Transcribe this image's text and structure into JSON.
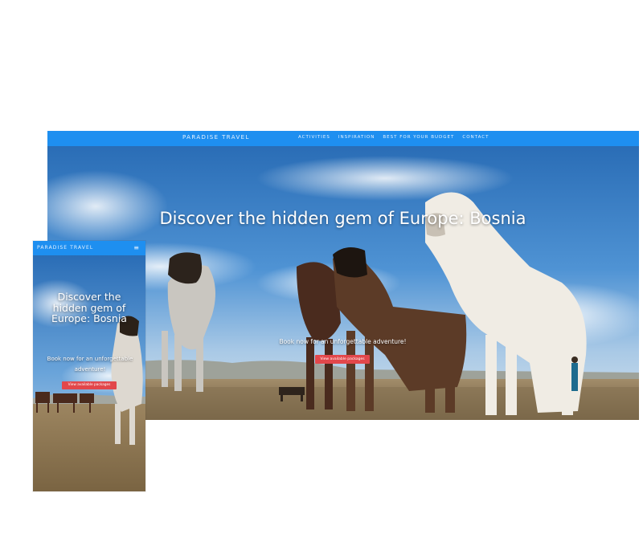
{
  "brand": "PARADISE TRAVEL",
  "nav": {
    "items": [
      {
        "label": "ACTIVITIES"
      },
      {
        "label": "INSPIRATION"
      },
      {
        "label": "BEST FOR YOUR BUDGET"
      },
      {
        "label": "CONTACT"
      }
    ],
    "menu_icon": "≡"
  },
  "hero": {
    "title": "Discover the hidden gem of Europe: Bosnia",
    "subtitle": "Book now for an unforgettable adventure!",
    "cta_label": "View available packages"
  },
  "colors": {
    "nav": "#1e8ff0",
    "cta": "#e2474b"
  },
  "icons": {
    "menu": "hamburger-menu-icon"
  }
}
